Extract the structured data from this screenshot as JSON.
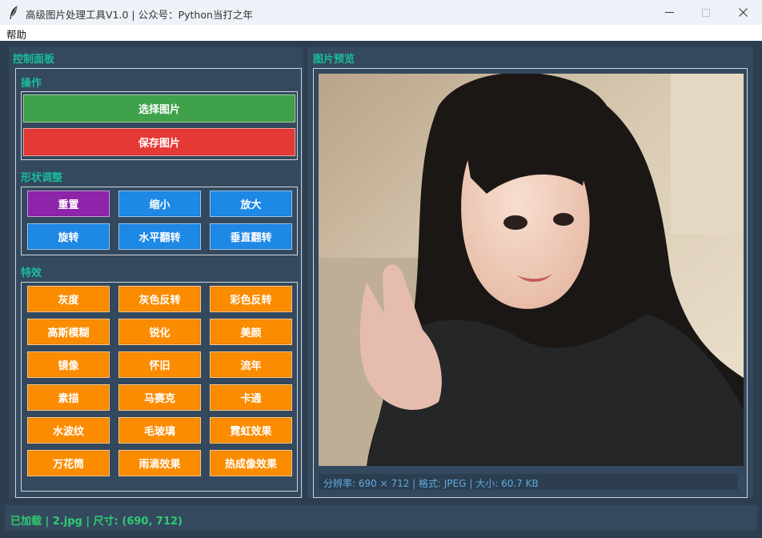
{
  "window": {
    "title": "高级图片处理工具V1.0 | 公众号：Python当打之年",
    "min_symbol": "—",
    "max_symbol": "☐",
    "close_symbol": "✕",
    "icon": "feather-icon"
  },
  "menu": {
    "help": "帮助"
  },
  "control_panel": {
    "title": "控制面板",
    "operations": {
      "title": "操作",
      "select_label": "选择图片",
      "save_label": "保存图片"
    },
    "shape": {
      "title": "形状调整",
      "buttons": [
        "重置",
        "缩小",
        "放大",
        "旋转",
        "水平翻转",
        "垂直翻转"
      ]
    },
    "effects": {
      "title": "特效",
      "buttons": [
        "灰度",
        "灰色反转",
        "彩色反转",
        "高斯模糊",
        "锐化",
        "美颜",
        "镜像",
        "怀旧",
        "流年",
        "素描",
        "马赛克",
        "卡通",
        "水波纹",
        "毛玻璃",
        "霓虹效果",
        "万花筒",
        "雨滴效果",
        "热成像效果"
      ]
    }
  },
  "preview": {
    "title": "图片预览",
    "info": "分辨率: 690 × 712 | 格式: JPEG | 大小: 60.7 KB"
  },
  "status": {
    "text": "已加载 | 2.jpg | 尺寸: (690, 712)"
  },
  "colors": {
    "background": "#2c3e50",
    "panel": "#34495e",
    "accent_teal": "#1abc9c",
    "status_green": "#2ecc71",
    "info_blue": "#5dade2",
    "button_green": "#3fa24a",
    "button_red": "#e53935",
    "button_purple": "#8e24aa",
    "button_blue": "#1e88e5",
    "button_orange": "#fb8c00"
  }
}
